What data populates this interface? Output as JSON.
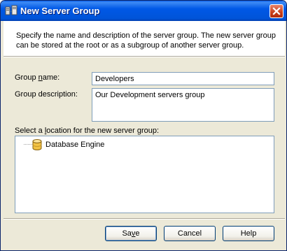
{
  "window": {
    "title": "New Server Group"
  },
  "intro": {
    "text": "Specify the name and description of the server group. The new server group can be stored at the root or as a subgroup of another server group."
  },
  "form": {
    "group_name_label_pre": "Group ",
    "group_name_label_acc": "n",
    "group_name_label_post": "ame:",
    "group_name_value": "Developers",
    "group_description_label": "Group description:",
    "group_description_value": "Our Development servers group",
    "location_label_pre": "Select a ",
    "location_label_acc": "l",
    "location_label_post": "ocation for the new server group:"
  },
  "tree": {
    "items": [
      {
        "label": "Database Engine",
        "icon": "database-icon"
      }
    ]
  },
  "buttons": {
    "save_pre": "Sa",
    "save_acc": "v",
    "save_post": "e",
    "cancel": "Cancel",
    "help": "Help"
  }
}
